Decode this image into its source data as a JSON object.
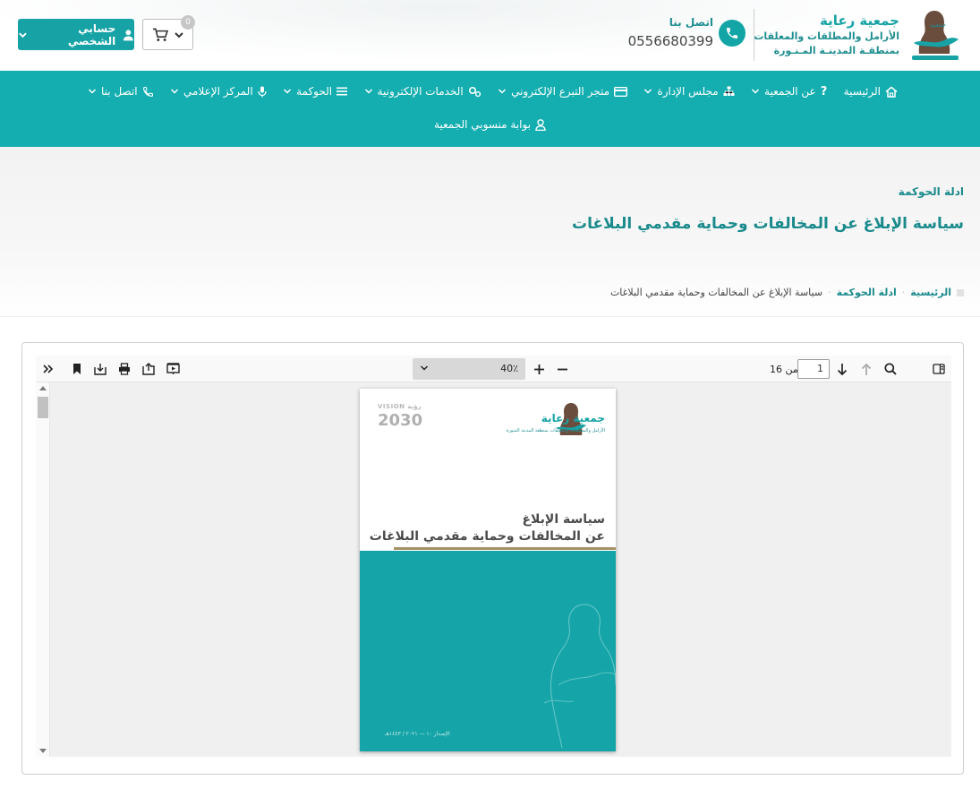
{
  "header": {
    "logo": {
      "title": "جمعية رعاية",
      "subtitle_line1": "الأرامل والمطلقات والمعلقات",
      "subtitle_line2": "بمنطقـة المدينـة المـنـورة"
    },
    "contact_label": "اتصل بنا",
    "contact_phone": "0556680399",
    "cart_count": "0",
    "account_label": "حسابي الشخصي"
  },
  "nav": {
    "items": [
      {
        "label": "الرئيسية",
        "icon": "home-icon",
        "dropdown": false
      },
      {
        "label": "عن الجمعية",
        "icon": "question-icon",
        "dropdown": true
      },
      {
        "label": "مجلس الإدارة",
        "icon": "sitemap-icon",
        "dropdown": true
      },
      {
        "label": "متجر التبرع الإلكتروني",
        "icon": "credit-card-icon",
        "dropdown": true
      },
      {
        "label": "الخدمات الإلكترونية",
        "icon": "cogs-icon",
        "dropdown": true
      },
      {
        "label": "الحوكمة",
        "icon": "list-icon",
        "dropdown": true
      },
      {
        "label": "المركز الإعلامي",
        "icon": "microphone-icon",
        "dropdown": true
      },
      {
        "label": "اتصل بنا",
        "icon": "phone-icon",
        "dropdown": true
      }
    ],
    "portal_label": "بوابة منسوبي الجمعية"
  },
  "page": {
    "category": "ادلة الحوكمة",
    "title": "سياسة الإبلاغ عن المخالفات وحماية مقدمي البلاغات",
    "breadcrumb": {
      "home": "الرئيسية",
      "category": "ادلة الحوكمة",
      "current": "سياسة الإبلاغ عن المخالفات وحماية مقدمي البلاغات"
    }
  },
  "viewer": {
    "zoom": "40٪",
    "page_number": "1",
    "page_count_label": "من 16",
    "document": {
      "logo_title": "جمعية رعاية",
      "logo_subtitle": "الأرامل والمطلقات والمعلقات بمنطقة المدينة المنورة",
      "vision_label": "VISION رؤية",
      "vision_year": "2030",
      "title_line1": "سياسة الإبلاغ",
      "title_line2": "عن المخالفات وحماية مقدمي البلاغات",
      "edition": "الإصدار ١٠ — ٢٠٢١ / ١٤٤٣هـ"
    }
  },
  "colors": {
    "brand_teal": "#14aeb0",
    "brand_dark_teal": "#1a8a8c",
    "gold": "#a59064"
  }
}
